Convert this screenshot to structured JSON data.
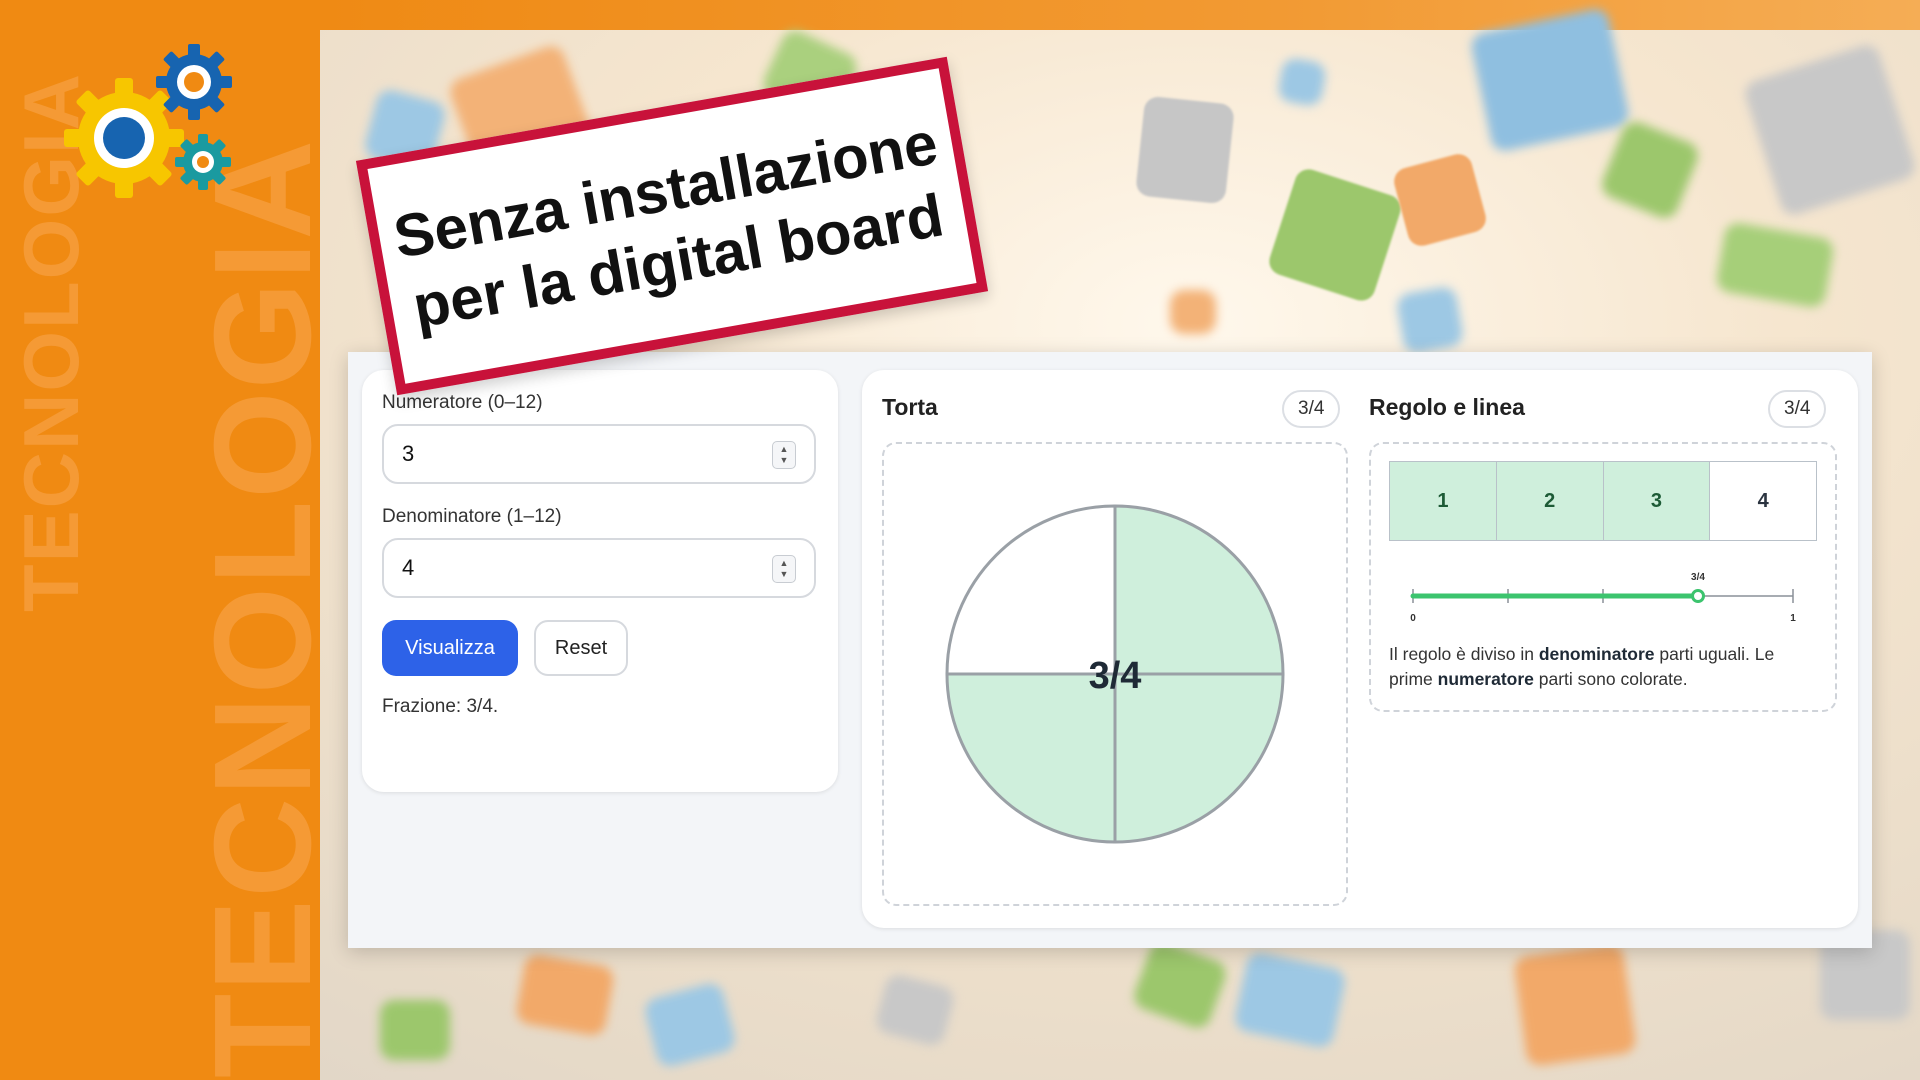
{
  "sidebar": {
    "brand_word": "TECNOLOGIA"
  },
  "banner": {
    "line1": "Senza installazione",
    "line2": "per la digital board"
  },
  "form": {
    "numerator_label": "Numeratore (0–12)",
    "numerator_value": "3",
    "denominator_label": "Denominatore (1–12)",
    "denominator_value": "4",
    "visualize_button": "Visualizza",
    "reset_button": "Reset",
    "status_text": "Frazione: 3/4."
  },
  "pie": {
    "title": "Torta",
    "badge": "3/4",
    "center_label": "3/4",
    "numerator": 3,
    "denominator": 4,
    "filled_color": "#cfefdc",
    "stroke_color": "#9aa0a6"
  },
  "ruler": {
    "title": "Regolo e linea",
    "badge": "3/4",
    "segments": [
      "1",
      "2",
      "3",
      "4"
    ],
    "filled_count": 3,
    "line_start_label": "0",
    "line_end_label": "1",
    "line_marker_label": "3/4",
    "line_value": 0.75,
    "desc_part1": "Il regolo è diviso in ",
    "desc_bold1": "denominatore",
    "desc_part2": " parti uguali. Le prime ",
    "desc_bold2": "numeratore",
    "desc_part3": " parti sono colorate.",
    "accent_color": "#3cc46e"
  },
  "colors": {
    "band_orange": "#f08a12",
    "banner_red": "#c8123a",
    "primary_blue": "#2d62e8"
  }
}
